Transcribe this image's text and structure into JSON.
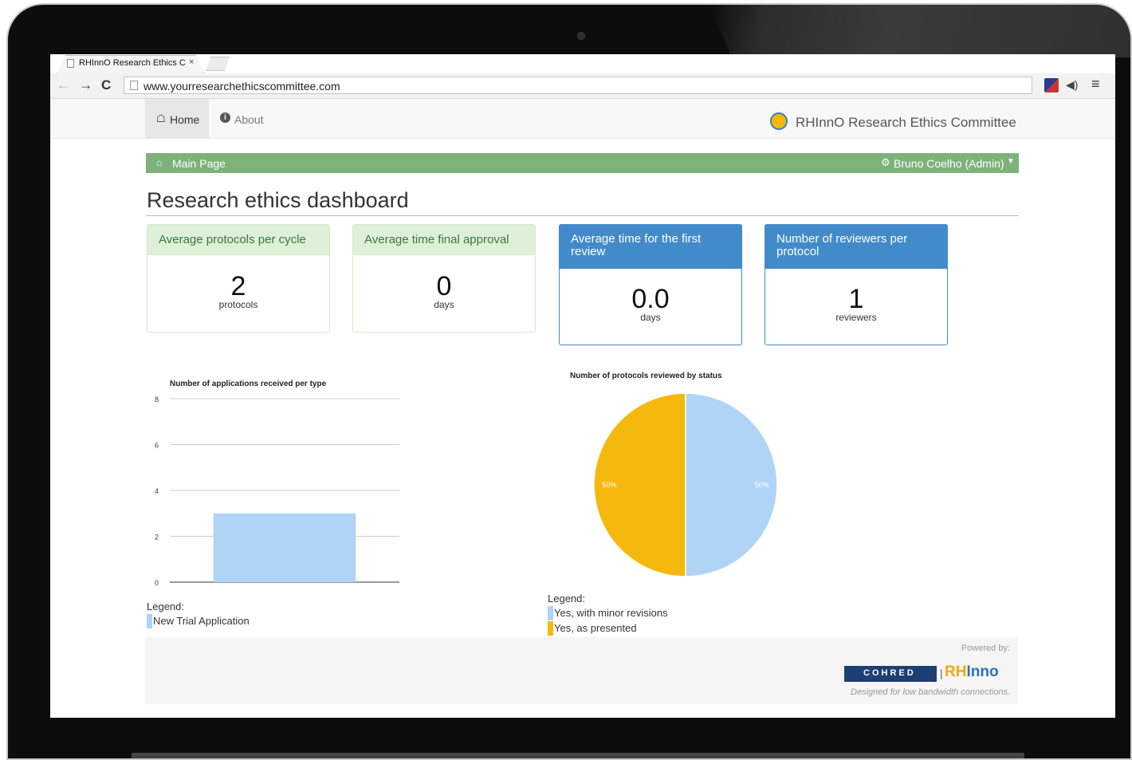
{
  "browser": {
    "tab_title": "RHInnO Research Ethics C",
    "tab_close": "×",
    "url": "www.yourresearchethicscommittee.com",
    "icons": [
      "back-icon",
      "forward-icon",
      "reload-icon",
      "page-icon",
      "extension-icon",
      "speaker-icon",
      "menu-icon"
    ]
  },
  "nav": {
    "home_label": "Home",
    "about_label": "About",
    "brand": "RHInnO Research Ethics Committee"
  },
  "bar": {
    "title": "Main Page",
    "user": "Bruno Coelho (Admin)"
  },
  "page_title": "Research ethics dashboard",
  "stats": [
    {
      "title": "Average protocols per cycle",
      "value": "2",
      "unit": "protocols"
    },
    {
      "title": "Average time final approval",
      "value": "0",
      "unit": "days"
    },
    {
      "title": "Average time for the first review",
      "value": "0.0",
      "unit": "days"
    },
    {
      "title": "Number of reviewers per protocol",
      "value": "1",
      "unit": "reviewers"
    }
  ],
  "chart_data": [
    {
      "type": "bar",
      "title": "Number of applications received per type",
      "categories": [
        "New Trial Application"
      ],
      "values": [
        3
      ],
      "yticks": [
        "0",
        "2",
        "4",
        "6",
        "8"
      ],
      "ylim": [
        0,
        8
      ],
      "grid": true,
      "legend_title": "Legend:",
      "series": [
        {
          "name": "New Trial Application",
          "values": [
            3
          ],
          "color": "#b0d4f5"
        }
      ]
    },
    {
      "type": "pie",
      "title": "Number of protocols reviewed by status",
      "slices": [
        {
          "label": "Yes, with minor revisions",
          "value": 50,
          "display": "50%",
          "color": "#b0d4f5"
        },
        {
          "label": "Yes, as presented",
          "value": 50,
          "display": "50%",
          "color": "#f5b90e"
        }
      ],
      "legend_title": "Legend:"
    }
  ],
  "footer": {
    "powered_by": "Powered by:",
    "cohred": "COHRED",
    "separator": "|",
    "rhinno_rh": "RH",
    "rhinno_inno": "Inno",
    "tagline": "Designed for low bandwidth connections."
  },
  "colors": {
    "green_bar": "#7db27a",
    "panel_blue": "#428bca",
    "panel_green": "#dff0d8"
  }
}
